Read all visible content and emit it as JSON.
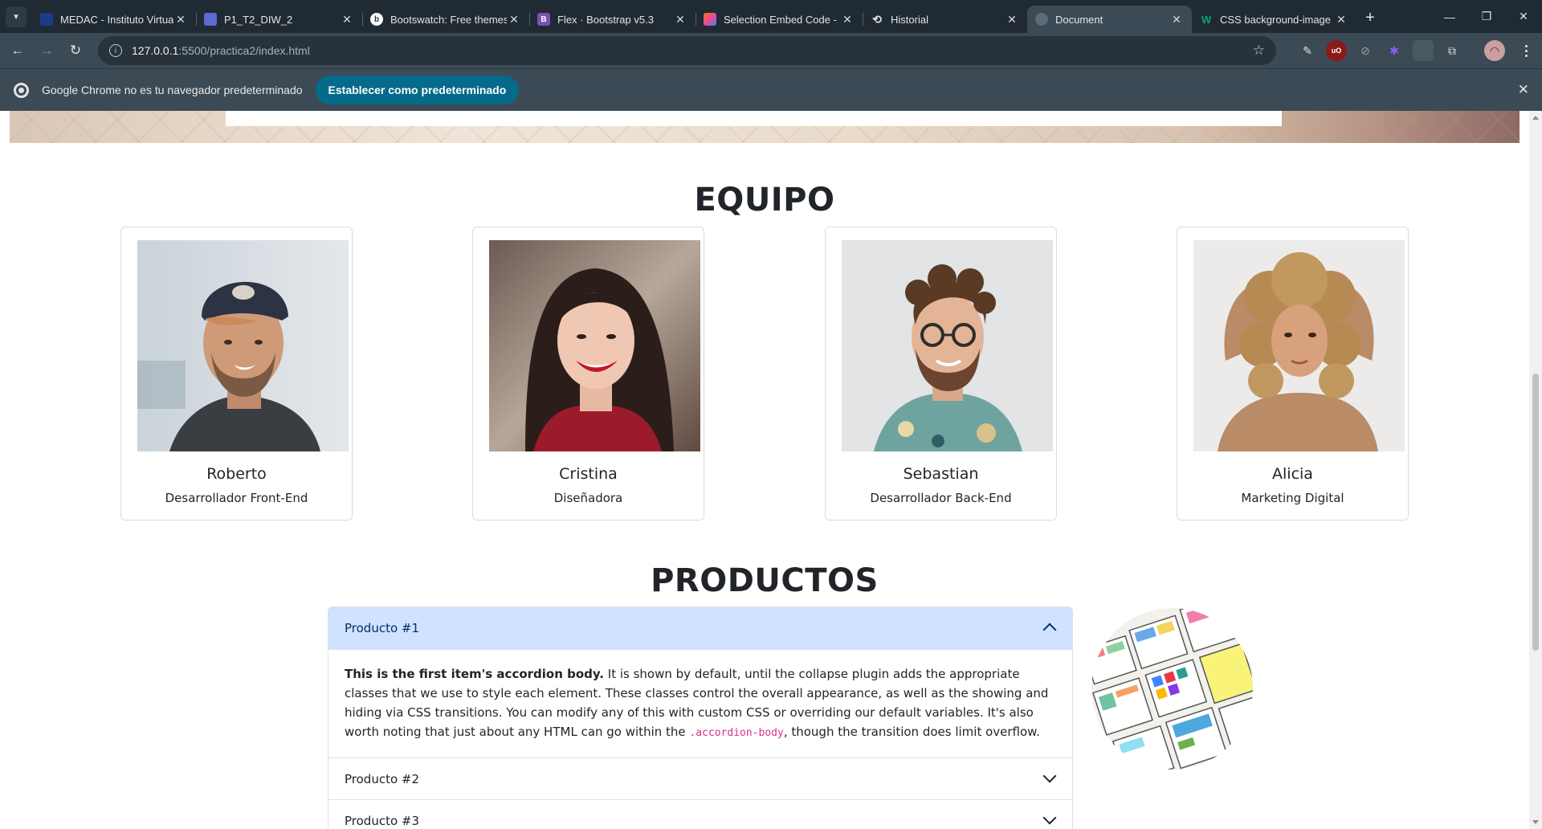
{
  "browser": {
    "tabs": [
      {
        "title": "MEDAC - Instituto Virtual",
        "favicon": "medac-icon",
        "color": "#1e3a8a",
        "active": false
      },
      {
        "title": "P1_T2_DIW_2",
        "favicon": "document-icon",
        "color": "#5d6bd1",
        "active": false
      },
      {
        "title": "Bootswatch: Free themes",
        "favicon": "bootswatch-icon",
        "color": "#ffffff",
        "active": false
      },
      {
        "title": "Flex · Bootstrap v5.3",
        "favicon": "bootstrap-icon",
        "color": "#7952b3",
        "active": false
      },
      {
        "title": "Selection Embed Code - C",
        "favicon": "embed-icon",
        "color": "#f97316",
        "active": false
      },
      {
        "title": "Historial",
        "favicon": "history-icon",
        "color": "#e3e3e3",
        "active": false
      },
      {
        "title": "Document",
        "favicon": "globe-icon",
        "color": "#5c6b76",
        "active": true
      },
      {
        "title": "CSS background-image p",
        "favicon": "w3schools-icon",
        "color": "#04aa6d",
        "active": false
      }
    ],
    "url_host": "127.0.0.1",
    "url_path": ":5500/practica2/index.html",
    "infobar": {
      "message": "Google Chrome no es tu navegador predeterminado",
      "button": "Establecer como predeterminado"
    }
  },
  "team": {
    "title": "EQUIPO",
    "members": [
      {
        "name": "Roberto",
        "role": "Desarrollador Front-End"
      },
      {
        "name": "Cristina",
        "role": "Diseñadora"
      },
      {
        "name": "Sebastian",
        "role": "Desarrollador Back-End"
      },
      {
        "name": "Alicia",
        "role": "Marketing Digital"
      }
    ]
  },
  "products": {
    "title": "PRODUCTOS",
    "items": [
      {
        "label": "Producto #1",
        "open": true
      },
      {
        "label": "Producto #2",
        "open": false
      },
      {
        "label": "Producto #3",
        "open": false
      }
    ],
    "body_strong": "This is the first item's accordion body.",
    "body_text": " It is shown by default, until the collapse plugin adds the appropriate classes that we use to style each element. These classes control the overall appearance, as well as the showing and hiding via CSS transitions. You can modify any of this with custom CSS or overriding our default variables. It's also worth noting that just about any HTML can go within the ",
    "body_code": ".accordion-body",
    "body_end": ", though the transition does limit overflow."
  }
}
